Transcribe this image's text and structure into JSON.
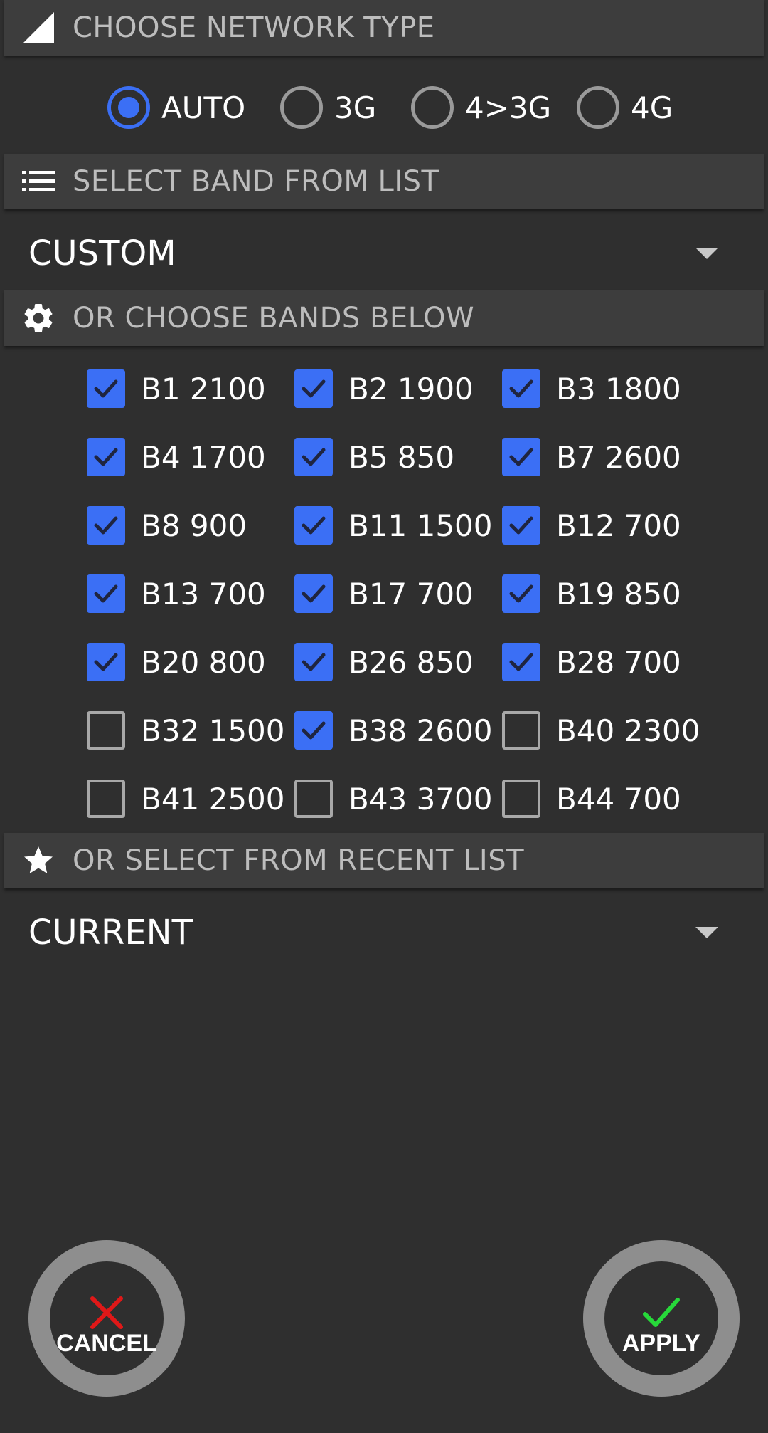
{
  "network_type": {
    "header": "CHOOSE NETWORK TYPE",
    "icon": "signal-icon",
    "options": [
      {
        "label": "AUTO",
        "selected": true
      },
      {
        "label": "3G",
        "selected": false
      },
      {
        "label": "4>3G",
        "selected": false
      },
      {
        "label": "4G",
        "selected": false
      }
    ]
  },
  "band_list": {
    "header": "SELECT BAND FROM LIST",
    "icon": "list-icon",
    "selected_value": "CUSTOM"
  },
  "bands": {
    "header": "OR CHOOSE BANDS BELOW",
    "icon": "gear-icon",
    "items": [
      {
        "label": "B1 2100",
        "checked": true
      },
      {
        "label": "B2 1900",
        "checked": true
      },
      {
        "label": "B3 1800",
        "checked": true
      },
      {
        "label": "B4 1700",
        "checked": true
      },
      {
        "label": "B5 850",
        "checked": true
      },
      {
        "label": "B7 2600",
        "checked": true
      },
      {
        "label": "B8 900",
        "checked": true
      },
      {
        "label": "B11 1500",
        "checked": true
      },
      {
        "label": "B12 700",
        "checked": true
      },
      {
        "label": "B13 700",
        "checked": true
      },
      {
        "label": "B17 700",
        "checked": true
      },
      {
        "label": "B19 850",
        "checked": true
      },
      {
        "label": "B20 800",
        "checked": true
      },
      {
        "label": "B26 850",
        "checked": true
      },
      {
        "label": "B28 700",
        "checked": true
      },
      {
        "label": "B32 1500",
        "checked": false
      },
      {
        "label": "B38 2600",
        "checked": true
      },
      {
        "label": "B40 2300",
        "checked": false
      },
      {
        "label": "B41 2500",
        "checked": false
      },
      {
        "label": "B43 3700",
        "checked": false
      },
      {
        "label": "B44 700",
        "checked": false
      }
    ]
  },
  "recent": {
    "header": "OR SELECT FROM RECENT LIST",
    "icon": "star-icon",
    "selected_value": "CURRENT"
  },
  "actions": {
    "cancel_label": "CANCEL",
    "cancel_icon": "close-icon",
    "apply_label": "APPLY",
    "apply_icon": "check-icon"
  },
  "colors": {
    "background": "#2f2f2f",
    "header_bg": "#3d3d3d",
    "accent": "#3b6ff5",
    "cancel_icon": "#e01818",
    "apply_icon": "#27d83a",
    "button_ring": "#8e8e8e"
  }
}
